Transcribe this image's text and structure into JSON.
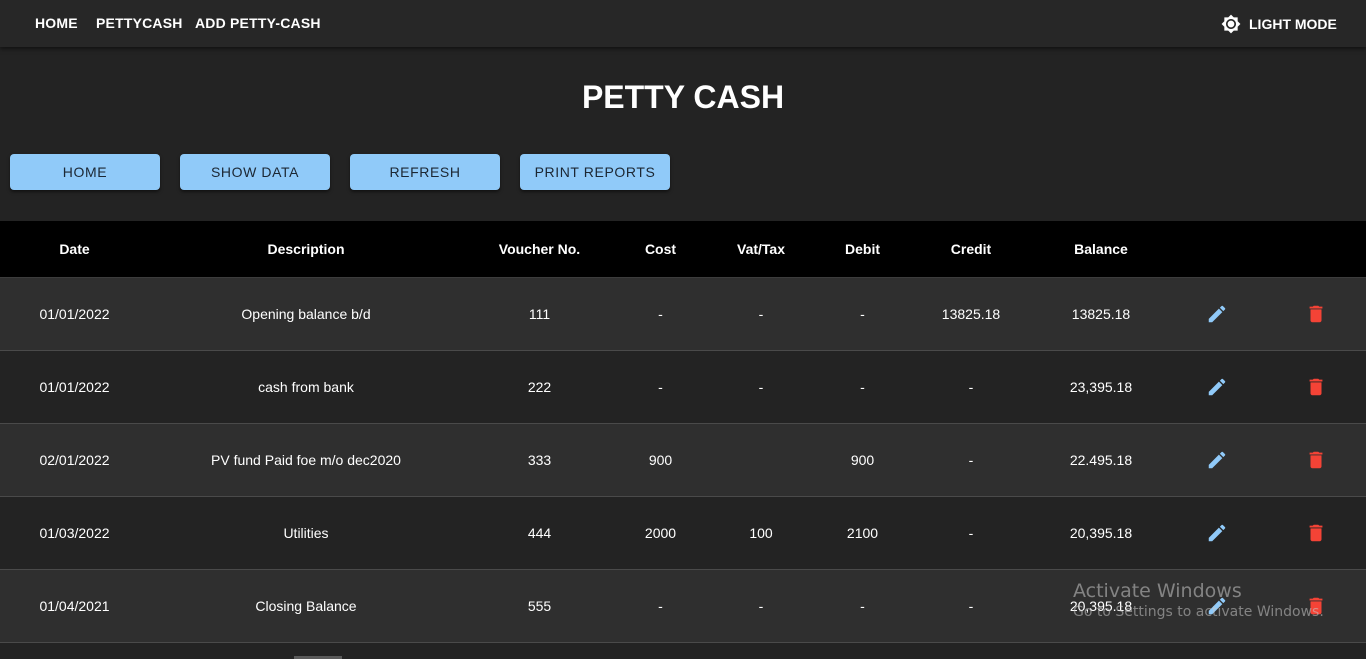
{
  "nav": {
    "links": [
      "HOME",
      "PETTYCASH",
      "ADD PETTY-CASH"
    ],
    "theme_toggle_label": "LIGHT MODE",
    "theme_icon": "brightness-gear-icon"
  },
  "page": {
    "title": "PETTY CASH"
  },
  "actions": {
    "home": "HOME",
    "show_data": "SHOW DATA",
    "refresh": "REFRESH",
    "print_reports": "PRINT REPORTS"
  },
  "table": {
    "headers": {
      "date": "Date",
      "description": "Description",
      "voucher": "Voucher No.",
      "cost": "Cost",
      "vat": "Vat/Tax",
      "debit": "Debit",
      "credit": "Credit",
      "balance": "Balance"
    },
    "rows": [
      {
        "date": "01/01/2022",
        "description": "Opening balance b/d",
        "voucher": "111",
        "cost": "-",
        "vat": "-",
        "debit": "-",
        "credit": "13825.18",
        "balance": "13825.18"
      },
      {
        "date": "01/01/2022",
        "description": "cash from bank",
        "voucher": "222",
        "cost": "-",
        "vat": "-",
        "debit": "-",
        "credit": "-",
        "balance": "23,395.18"
      },
      {
        "date": "02/01/2022",
        "description": "PV fund Paid foe m/o dec2020",
        "voucher": "333",
        "cost": "900",
        "vat": "",
        "debit": "900",
        "credit": "-",
        "balance": "22.495.18"
      },
      {
        "date": "01/03/2022",
        "description": "Utilities",
        "voucher": "444",
        "cost": "2000",
        "vat": "100",
        "debit": "2100",
        "credit": "-",
        "balance": "20,395.18"
      },
      {
        "date": "01/04/2021",
        "description": "Closing Balance",
        "voucher": "555",
        "cost": "-",
        "vat": "-",
        "debit": "-",
        "credit": "-",
        "balance": "20,395.18"
      }
    ],
    "edit_icon": "pencil-icon",
    "delete_icon": "trash-icon"
  },
  "watermark": {
    "title": "Activate Windows",
    "subtitle": "Go to Settings to activate Windows."
  },
  "colors": {
    "background": "#232323",
    "topbar": "#272727",
    "header_row": "#000000",
    "row_odd": "#2f2f2f",
    "row_even": "#232323",
    "button": "#90caf9",
    "edit_icon": "#90caf9",
    "delete_icon": "#f44336"
  }
}
